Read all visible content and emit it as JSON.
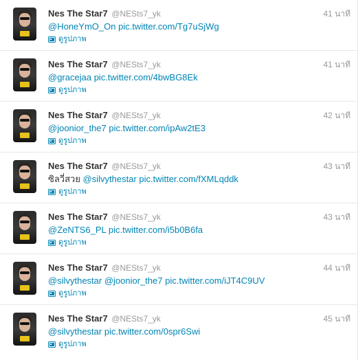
{
  "tweets": [
    {
      "name": "Nes The Star7",
      "handle": "@NESts7_yk",
      "time": "41 นาที",
      "prefix": "",
      "mentions": [
        "@HoneYmO_On"
      ],
      "link": "pic.twitter.com/Tg7uSjWg",
      "view_label": "ดูรูปภาพ"
    },
    {
      "name": "Nes The Star7",
      "handle": "@NESts7_yk",
      "time": "41 นาที",
      "prefix": "",
      "mentions": [
        "@gracejaa"
      ],
      "link": "pic.twitter.com/4bwBG8Ek",
      "view_label": "ดูรูปภาพ"
    },
    {
      "name": "Nes The Star7",
      "handle": "@NESts7_yk",
      "time": "42 นาที",
      "prefix": "",
      "mentions": [
        "@joonior_the7"
      ],
      "link": "pic.twitter.com/ipAw2tE3",
      "view_label": "ดูรูปภาพ"
    },
    {
      "name": "Nes The Star7",
      "handle": "@NESts7_yk",
      "time": "43 นาที",
      "prefix": "ซิลวี่สวย",
      "mentions": [
        "@silvythestar"
      ],
      "link": "pic.twitter.com/fXMLqddk",
      "view_label": "ดูรูปภาพ"
    },
    {
      "name": "Nes The Star7",
      "handle": "@NESts7_yk",
      "time": "43 นาที",
      "prefix": "",
      "mentions": [
        "@ZeNTS6_PL"
      ],
      "link": "pic.twitter.com/i5b0B6fa",
      "view_label": "ดูรูปภาพ"
    },
    {
      "name": "Nes The Star7",
      "handle": "@NESts7_yk",
      "time": "44 นาที",
      "prefix": "",
      "mentions": [
        "@silvythestar",
        "@joonior_the7"
      ],
      "link": "pic.twitter.com/iJT4C9UV",
      "view_label": "ดูรูปภาพ"
    },
    {
      "name": "Nes The Star7",
      "handle": "@NESts7_yk",
      "time": "45 นาที",
      "prefix": "",
      "mentions": [
        "@silvythestar"
      ],
      "link": "pic.twitter.com/0spr6Swi",
      "view_label": "ดูรูปภาพ"
    }
  ],
  "colors": {
    "link": "#0084b4",
    "name": "#333333",
    "muted": "#999999",
    "divider": "#e8e8e8"
  },
  "icons": {
    "avatar": "user-avatar-photo",
    "photo": "photo-icon"
  }
}
